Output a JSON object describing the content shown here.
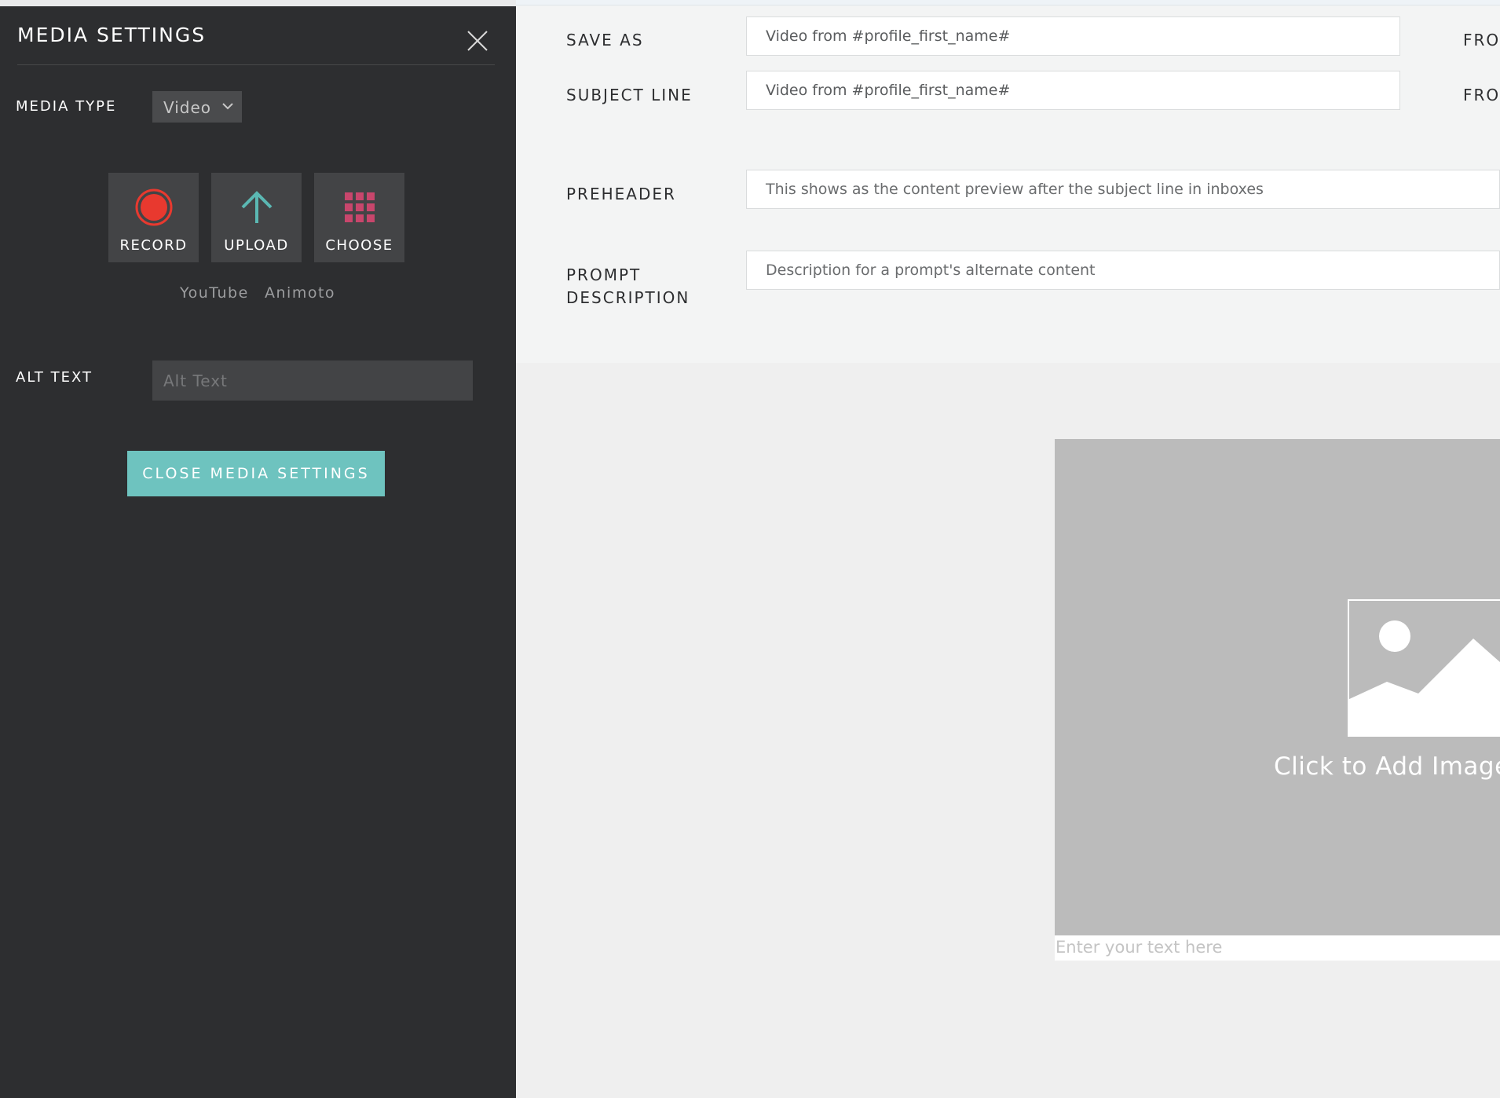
{
  "media_panel": {
    "title": "MEDIA SETTINGS",
    "media_type_label": "MEDIA TYPE",
    "media_type_value": "Video",
    "tiles": [
      {
        "label": "RECORD",
        "icon": "record-icon",
        "color": "#e8392f"
      },
      {
        "label": "UPLOAD",
        "icon": "upload-arrow-icon",
        "color": "#5bb8b3"
      },
      {
        "label": "CHOOSE",
        "icon": "grid-icon",
        "color": "#c8466c"
      }
    ],
    "sources": [
      "YouTube",
      "Animoto"
    ],
    "alt_text_label": "ALT TEXT",
    "alt_text_placeholder": "Alt Text",
    "alt_text_value": "",
    "close_button_label": "CLOSE MEDIA SETTINGS",
    "accent_color": "#6ec3bf"
  },
  "form": {
    "save_as_label": "SAVE AS",
    "save_as_value": "Video from #profile_first_name#",
    "subject_line_label": "SUBJECT LINE",
    "subject_line_value": "Video from #profile_first_name#",
    "from_label_1": "FRO",
    "from_label_2": "FRO",
    "preheader_label": "PREHEADER",
    "preheader_placeholder": "This shows as the content preview after the subject line in inboxes",
    "prompt_description_label_line1": "PROMPT",
    "prompt_description_label_line2": "DESCRIPTION",
    "prompt_description_placeholder": "Description for a prompt's alternate content"
  },
  "canvas": {
    "image_cta": "Click to Add Image o",
    "caption_placeholder": "Enter your text here"
  }
}
